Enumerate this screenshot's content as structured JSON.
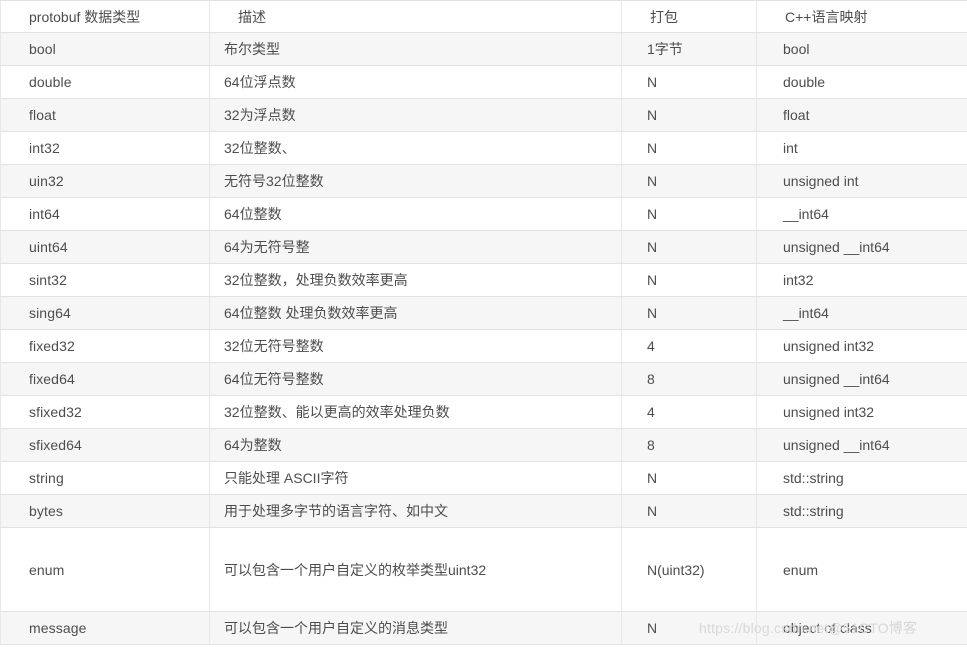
{
  "table": {
    "headers": [
      "protobuf 数据类型",
      "描述",
      "打包",
      "C++语言映射"
    ],
    "rows": [
      {
        "type": "bool",
        "desc": "布尔类型",
        "pack": "1字节",
        "cpp": "bool"
      },
      {
        "type": "double",
        "desc": "64位浮点数",
        "pack": "N",
        "cpp": "double"
      },
      {
        "type": "float",
        "desc": "32为浮点数",
        "pack": "N",
        "cpp": "float"
      },
      {
        "type": "int32",
        "desc": "32位整数、",
        "pack": "N",
        "cpp": "int"
      },
      {
        "type": "uin32",
        "desc": "无符号32位整数",
        "pack": "N",
        "cpp": "unsigned int"
      },
      {
        "type": "int64",
        "desc": "64位整数",
        "pack": "N",
        "cpp": "__int64"
      },
      {
        "type": "uint64",
        "desc": "64为无符号整",
        "pack": "N",
        "cpp": "unsigned __int64"
      },
      {
        "type": "sint32",
        "desc": "32位整数，处理负数效率更高",
        "pack": "N",
        "cpp": "int32"
      },
      {
        "type": "sing64",
        "desc": "64位整数 处理负数效率更高",
        "pack": "N",
        "cpp": "__int64"
      },
      {
        "type": "fixed32",
        "desc": "32位无符号整数",
        "pack": "4",
        "cpp": "unsigned int32"
      },
      {
        "type": "fixed64",
        "desc": "64位无符号整数",
        "pack": "8",
        "cpp": "unsigned __int64"
      },
      {
        "type": "sfixed32",
        "desc": "32位整数、能以更高的效率处理负数",
        "pack": "4",
        "cpp": "unsigned int32"
      },
      {
        "type": "sfixed64",
        "desc": "64为整数",
        "pack": "8",
        "cpp": "unsigned __int64"
      },
      {
        "type": "string",
        "desc": "只能处理 ASCII字符",
        "pack": "N",
        "cpp": "std::string"
      },
      {
        "type": "bytes",
        "desc": "用于处理多字节的语言字符、如中文",
        "pack": "N",
        "cpp": "std::string"
      },
      {
        "type": "enum",
        "desc": "可以包含一个用户自定义的枚举类型uint32",
        "pack": "N(uint32)",
        "cpp": "enum",
        "tall": true
      },
      {
        "type": "message",
        "desc": "可以包含一个用户自定义的消息类型",
        "pack": "N",
        "cpp": "object of class"
      }
    ]
  },
  "watermark": {
    "text": "https://blog.csdn.net@51CTO博客"
  },
  "colors": {
    "border": "#e3e3e3",
    "row_alt": "#f6f6f6",
    "row_base": "#ffffff",
    "text": "#4d4d4d",
    "watermark": "#d8d8d8"
  }
}
